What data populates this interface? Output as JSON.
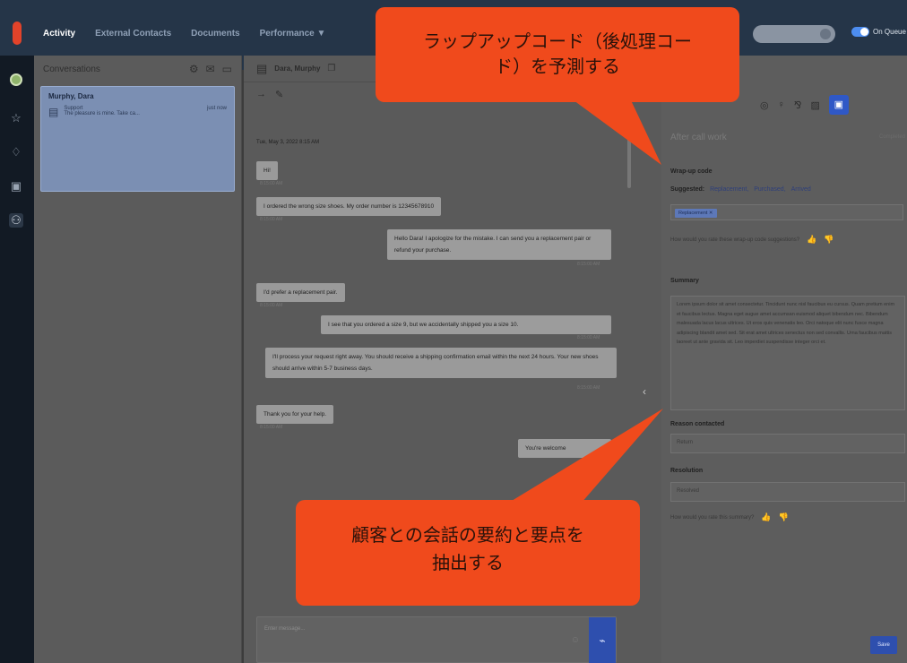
{
  "colors": {
    "topbar": "#253548",
    "accent": "#2f58c6",
    "callout": "#f04a1c",
    "chip": "#5d78b8"
  },
  "topbar": {
    "tabs": [
      "Activity",
      "External Contacts",
      "Documents",
      "Performance ▼"
    ],
    "queue_label": "On Queue"
  },
  "conversations": {
    "title": "Conversations",
    "icons": [
      "gear-icon",
      "mail-icon",
      "chat-icon"
    ],
    "items": [
      {
        "name": "Murphy, Dara",
        "type": "Support",
        "preview": "The pleasure is mine. Take ca...",
        "time": "just now"
      }
    ]
  },
  "chat": {
    "header_name": "Dara, Murphy",
    "date": "Tue, May 3, 2022 8:15 AM",
    "messages": [
      {
        "side": "left",
        "text": "Hi!",
        "ts": "8:15:00 AM"
      },
      {
        "side": "left",
        "text": "I ordered the wrong size shoes. My order number is 12345678910",
        "ts": "8:15:00 AM"
      },
      {
        "side": "right",
        "text": "Hello Dara! I apologize for the mistake. I can send you a replacement pair or refund your purchase.",
        "ts": "8:15:00 AM"
      },
      {
        "side": "left",
        "text": "I'd prefer a replacement pair.",
        "ts": "8:15:00 AM"
      },
      {
        "side": "right",
        "text": "I see that you ordered a size 9, but we accidentally shipped you a size 10.",
        "ts": "8:15:00 AM"
      },
      {
        "side": "left",
        "text": "I'll process your request right away. You should receive a shipping confirmation email within the next 24 hours. Your new shoes should arrive within 5-7 business days.",
        "ts": "8:15:00 AM"
      },
      {
        "side": "left",
        "text": "Thank you for your help.",
        "ts": "8:15:00 AM"
      },
      {
        "side": "right",
        "text": "You're welcome",
        "ts": ""
      }
    ],
    "composer_placeholder": "Enter message..."
  },
  "acw": {
    "title": "After call work",
    "status": "Completed",
    "wrapup_label": "Wrap-up code",
    "suggested_label": "Suggested:",
    "suggestions": [
      "Replacement,",
      "Purchased,",
      "Arrived"
    ],
    "chip": "Replacement ✕",
    "rate_code": "How would you rate these wrap-up code suggestions?",
    "summary_label": "Summary",
    "summary_text": "Lorem ipsum dolor sit amet consectetur. Tincidunt nunc nisl faucibus eu cursus. Quam pretium enim et faucibus lectus. Magna eget augue amet accumsan euismod aliquet bibendum nec. Bibendum malesuada lacus lacus ultrices. Ut eros quis venenatis leo. Orci natoque elit nunc fusce magna adipiscing blandit amet sed. Sit erat amet ultrices senectus non sed convallis. Urna faucibus mattis laoreet ut ante gravida sit. Leo imperdiet suspendisse integer orci et.",
    "reason_label": "Reason contacted",
    "reason_value": "Return",
    "resolution_label": "Resolution",
    "resolution_value": "Resolved",
    "rate_summary": "How would you rate this summary?",
    "save": "Save"
  },
  "callouts": {
    "top": [
      "ラップアップコード（後処理コー",
      "ド）を予測する"
    ],
    "bottom": [
      "顧客との会話の要約と要点を",
      "抽出する"
    ]
  }
}
